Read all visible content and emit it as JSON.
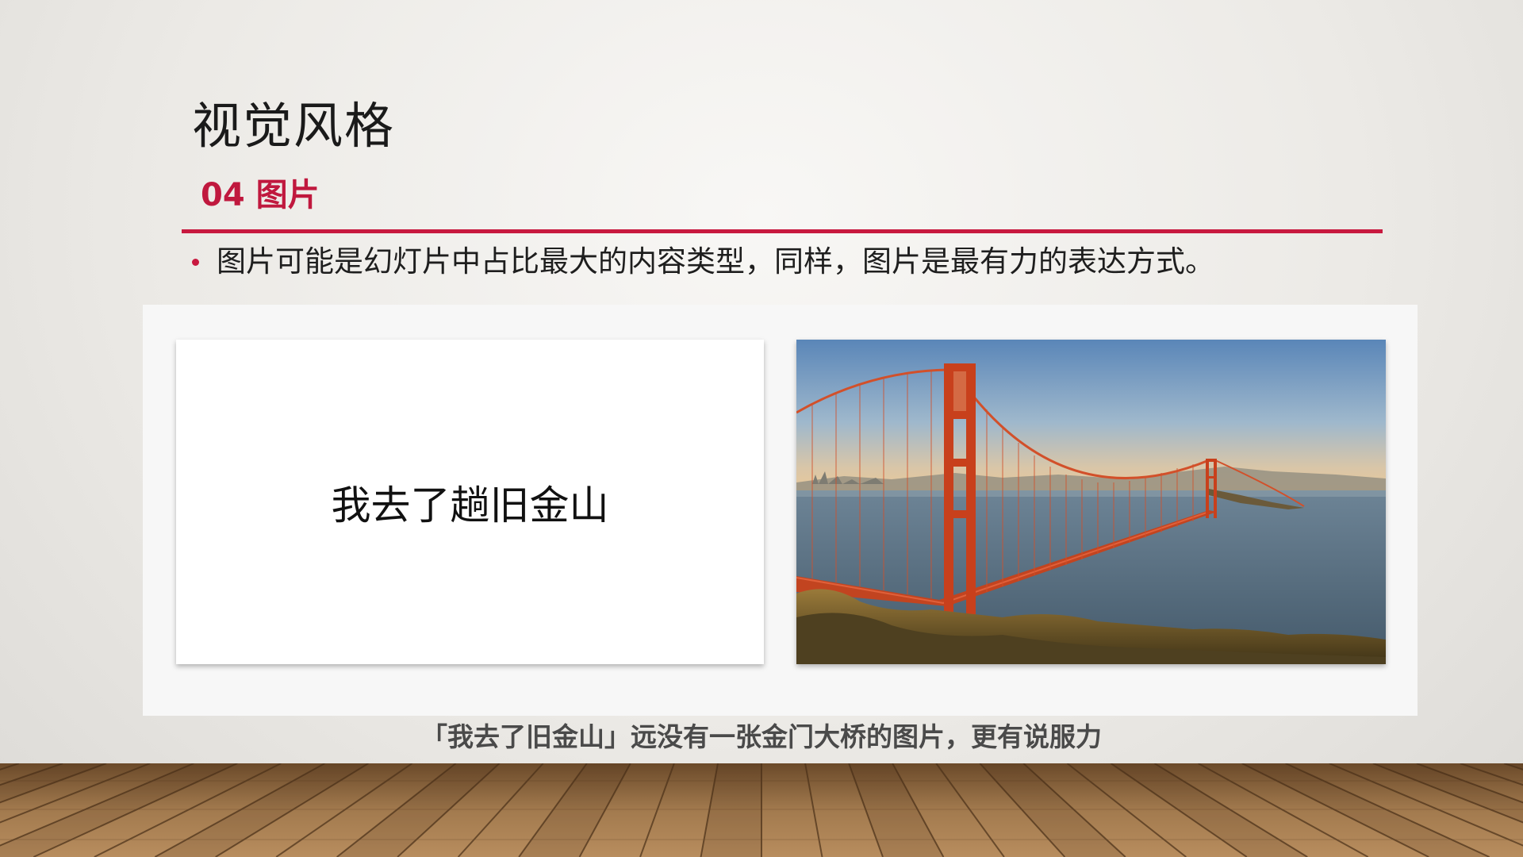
{
  "slide": {
    "title": "视觉风格",
    "section_label": "04 图片",
    "bullet_text": "图片可能是幻灯片中占比最大的内容类型，同样，图片是最有力的表达方式。",
    "accent_color": "#c8193f"
  },
  "comparison": {
    "text_card_label": "我去了趟旧金山",
    "photo_subject": "golden-gate-bridge"
  },
  "caption": "「我去了旧金山」远没有一张金门大桥的图片，更有说服力",
  "floor": {
    "material": "wood-planks"
  }
}
